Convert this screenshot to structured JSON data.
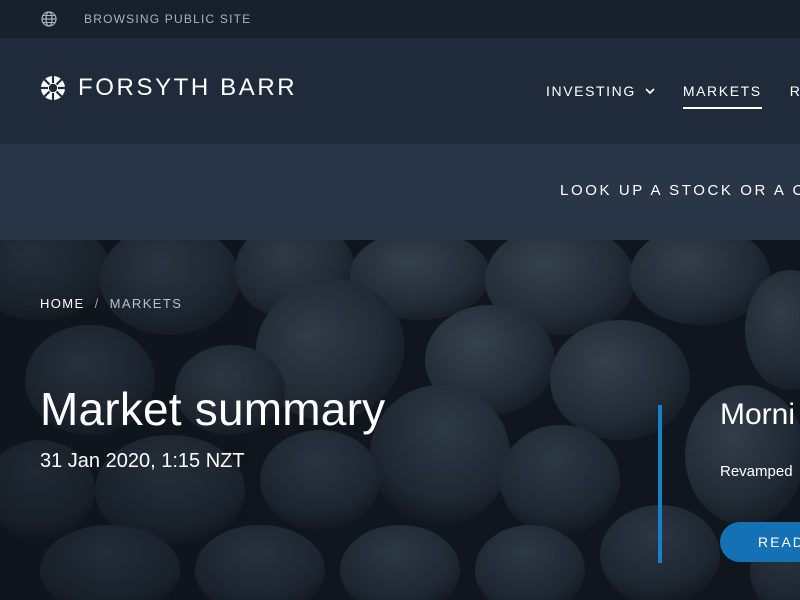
{
  "utility_bar": {
    "icon": "globe-icon",
    "text": "BROWSING PUBLIC SITE"
  },
  "header": {
    "logo_text": "FORSYTH BARR",
    "nav": [
      {
        "label": "INVESTING",
        "has_dropdown": true,
        "active": false
      },
      {
        "label": "MARKETS",
        "has_dropdown": false,
        "active": true
      },
      {
        "label": "R",
        "has_dropdown": false,
        "active": false
      }
    ]
  },
  "lookup": {
    "text": "LOOK UP A STOCK OR A CO"
  },
  "breadcrumb": {
    "home": "HOME",
    "separator": "/",
    "current": "MARKETS"
  },
  "hero": {
    "title": "Market summary",
    "date": "31 Jan 2020, 1:15 NZT"
  },
  "feature": {
    "title": "Morni",
    "text": "Revamped",
    "button_label": "READ"
  },
  "colors": {
    "accent": "#1b7fc4",
    "button": "#1471b4",
    "header_bg": "#1f2b3a",
    "lookup_bg": "#283648"
  }
}
